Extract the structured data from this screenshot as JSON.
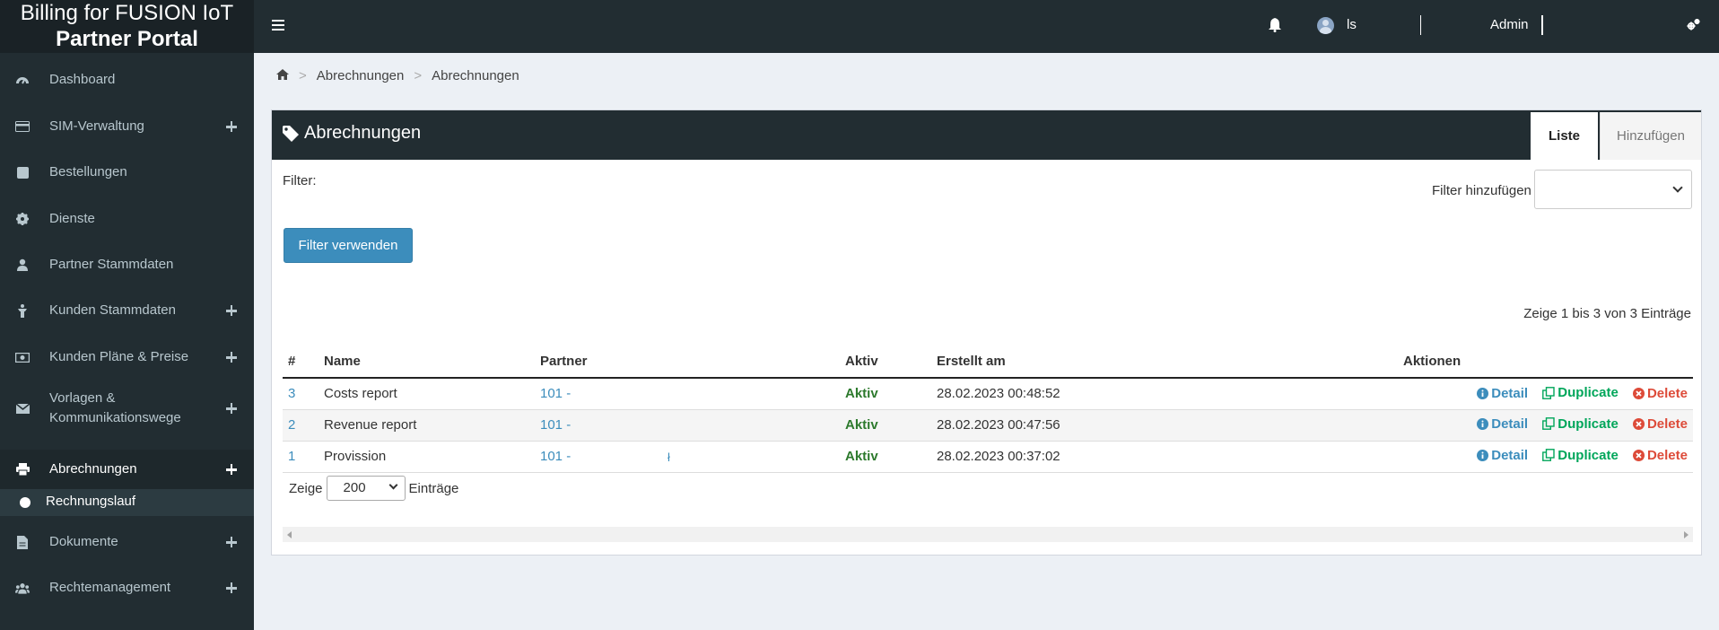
{
  "brand": {
    "line1": "Billing for FUSION IoT",
    "line2": "Partner Portal"
  },
  "sidebar": {
    "items": [
      {
        "label": "Dashboard",
        "icon": "dashboard-icon"
      },
      {
        "label": "SIM-Verwaltung",
        "icon": "credit-card-icon",
        "expandable": true
      },
      {
        "label": "Bestellungen",
        "icon": "square-icon"
      },
      {
        "label": "Dienste",
        "icon": "gear-icon"
      },
      {
        "label": "Partner Stammdaten",
        "icon": "user-icon"
      },
      {
        "label": "Kunden Stammdaten",
        "icon": "person-icon",
        "expandable": true
      },
      {
        "label": "Kunden Pläne & Preise",
        "icon": "money-icon",
        "expandable": true
      },
      {
        "label": "Vorlagen & Kommunikationswege",
        "icon": "envelope-icon",
        "expandable": true
      },
      {
        "label": "Abrechnungen",
        "icon": "print-icon",
        "expandable": true,
        "active": true
      },
      {
        "label": "Dokumente",
        "icon": "file-icon",
        "expandable": true
      },
      {
        "label": "Rechtemanagement",
        "icon": "users-icon",
        "expandable": true
      }
    ],
    "submenu": {
      "label": "Rechnungslauf"
    }
  },
  "topbar": {
    "user_name": "ls",
    "role": "Admin"
  },
  "breadcrumb": [
    "Abrechnungen",
    "Abrechnungen"
  ],
  "panel": {
    "title": "Abrechnungen",
    "tabs": [
      {
        "label": "Liste",
        "active": true
      },
      {
        "label": "Hinzufügen",
        "active": false
      }
    ],
    "filter_label": "Filter:",
    "filter_add_label": "Filter hinzufügen",
    "filter_add_value": "",
    "filter_button": "Filter verwenden",
    "info": "Zeige 1 bis 3 von 3 Einträge",
    "table": {
      "headers": [
        "#",
        "Name",
        "Partner",
        "Aktiv",
        "Erstellt am",
        "Aktionen"
      ],
      "rows": [
        {
          "id": "3",
          "name": "Costs report",
          "partner": "101 -",
          "partner_extra": "",
          "aktiv": "Aktiv",
          "created": "28.02.2023 00:48:52"
        },
        {
          "id": "2",
          "name": "Revenue report",
          "partner": "101 -",
          "partner_extra": "",
          "aktiv": "Aktiv",
          "created": "28.02.2023 00:47:56"
        },
        {
          "id": "1",
          "name": "Provission",
          "partner": "101 -",
          "partner_extra": "ł",
          "aktiv": "Aktiv",
          "created": "28.02.2023 00:37:02"
        }
      ],
      "actions": {
        "detail": "Detail",
        "duplicate": "Duplicate",
        "delete": "Delete"
      }
    },
    "length": {
      "prefix": "Zeige",
      "value": "200",
      "suffix": "Einträge"
    }
  },
  "colors": {
    "sidebar_bg": "#222d32",
    "primary": "#3c8dbc",
    "success": "#00a65a",
    "danger": "#dd4b39",
    "aktiv_text": "#2d7a2d"
  }
}
